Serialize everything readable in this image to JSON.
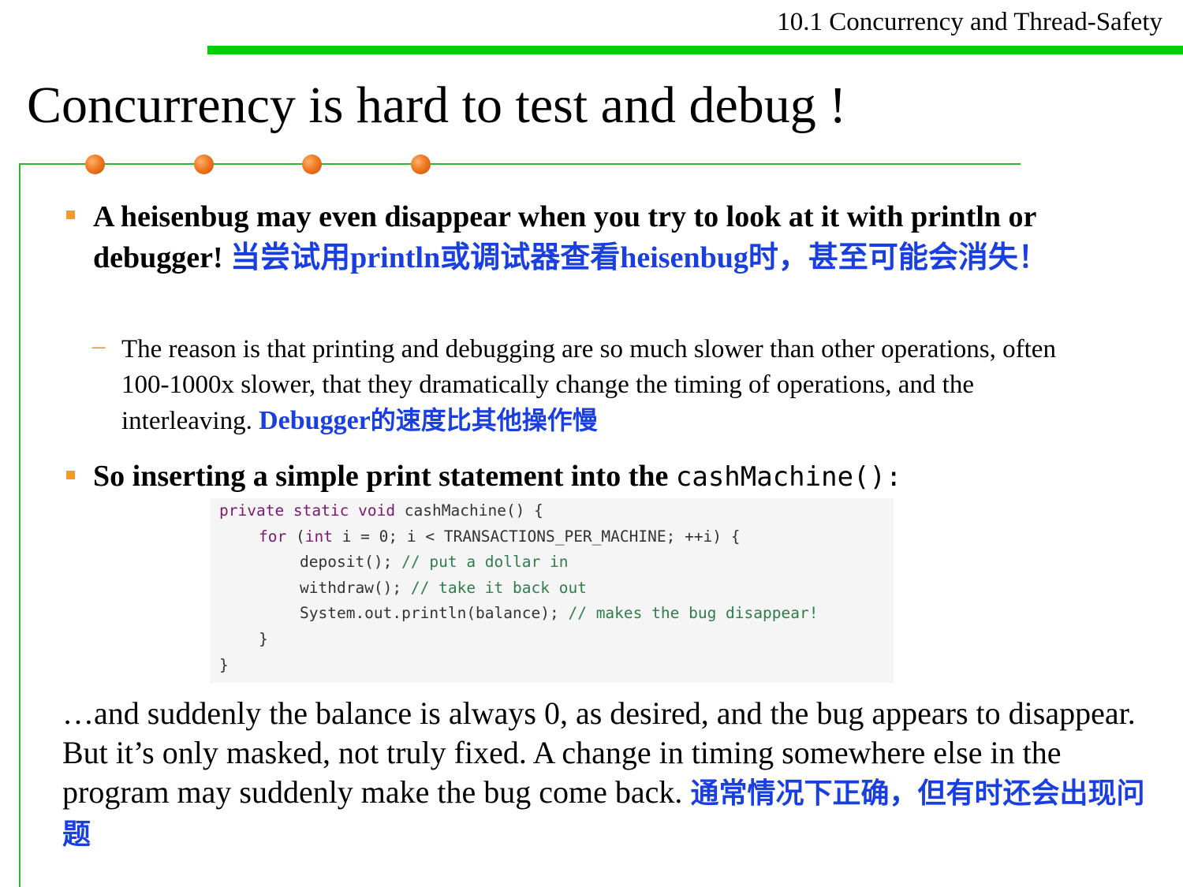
{
  "header": {
    "section": "10.1 Concurrency and Thread-Safety"
  },
  "slide": {
    "title": "Concurrency is hard to test and debug !"
  },
  "bullets": [
    {
      "en": "A heisenbug may even disappear when you try to look at it with println or debugger!",
      "zh_1": "当尝试用",
      "zh_2": "println",
      "zh_3": "或调试器查看",
      "zh_4": "heisenbug",
      "zh_5": "时，甚至可能会消失！"
    },
    {
      "en": "So inserting a simple print statement into the",
      "code": "cashMachine():"
    }
  ],
  "sub_bullet": {
    "en": "The reason is that printing and debugging are so much slower than other operations, often 100-1000x slower, that they dramatically change the timing of operations, and the interleaving.",
    "zh_latin": "Debugger",
    "zh": "的速度比其他操作慢"
  },
  "code": {
    "line1_kw": "private static void",
    "line1_rest": " cashMachine() {",
    "line2_kw": "for",
    "line2_mid": " (",
    "line2_kw2": "int",
    "line2_rest": " i = 0; i < TRANSACTIONS_PER_MACHINE; ++i) {",
    "line3_code": "deposit(); ",
    "line3_cm": "// put a dollar in",
    "line4_code": "withdraw(); ",
    "line4_cm": "// take it back out",
    "line5_code": "System.out.println(balance); ",
    "line5_cm": "// makes the bug disappear!",
    "line6": "}",
    "line7": "}"
  },
  "paragraph": {
    "en": "…and suddenly the balance is always 0, as desired, and the bug appears to disappear. But it’s only masked, not truly fixed. A change in timing somewhere else in the program may suddenly make the bug come back.",
    "zh": "通常情况下正确，但有时还会出现问题"
  },
  "colors": {
    "accent_green": "#00d000",
    "bullet_orange": "#f39a2a",
    "chinese_blue": "#1a3fe0"
  }
}
